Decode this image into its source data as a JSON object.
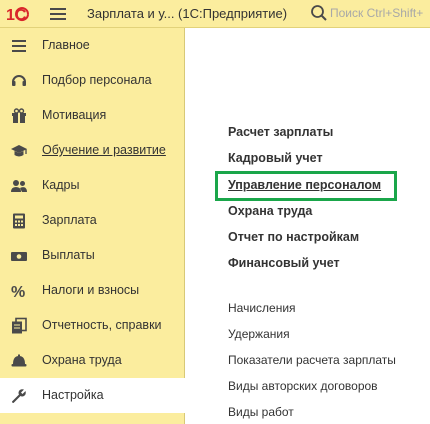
{
  "app": {
    "title": "Зарплата и у...  (1С:Предприятие)",
    "search_placeholder": "Поиск Ctrl+Shift+"
  },
  "sidebar": {
    "items": [
      {
        "label": "Главное",
        "icon": "list-icon"
      },
      {
        "label": "Подбор персонала",
        "icon": "headset-icon"
      },
      {
        "label": "Мотивация",
        "icon": "gift-icon"
      },
      {
        "label": "Обучение и развитие",
        "icon": "graduation-cap-icon"
      },
      {
        "label": "Кадры",
        "icon": "people-icon"
      },
      {
        "label": "Зарплата",
        "icon": "calculator-icon"
      },
      {
        "label": "Выплаты",
        "icon": "cash-icon"
      },
      {
        "label": "Налоги и взносы",
        "icon": "percent-icon"
      },
      {
        "label": "Отчетность, справки",
        "icon": "documents-icon"
      },
      {
        "label": "Охрана труда",
        "icon": "helmet-icon"
      },
      {
        "label": "Настройка",
        "icon": "wrench-icon"
      }
    ],
    "active_index": 10
  },
  "main": {
    "sections": [
      {
        "label": "Расчет зарплаты"
      },
      {
        "label": "Кадровый учет"
      },
      {
        "label": "Управление персоналом"
      },
      {
        "label": "Охрана труда"
      },
      {
        "label": "Отчет по настройкам"
      },
      {
        "label": "Финансовый учет"
      }
    ],
    "links": [
      {
        "label": "Начисления"
      },
      {
        "label": "Удержания"
      },
      {
        "label": "Показатели расчета зарплаты"
      },
      {
        "label": "Виды авторских договоров"
      },
      {
        "label": "Виды работ"
      }
    ]
  },
  "colors": {
    "panel_bg": "#fbed9e",
    "highlight": "#1aa64a",
    "logo_red": "#d9262b",
    "icon_dark": "#4a4a4a"
  }
}
